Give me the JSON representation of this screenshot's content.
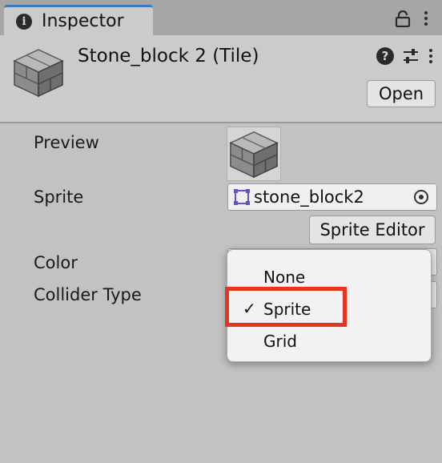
{
  "window": {
    "tab_label": "Inspector"
  },
  "header": {
    "asset_title": "Stone_block 2 (Tile)",
    "open_button": "Open"
  },
  "properties": {
    "preview_label": "Preview",
    "sprite_label": "Sprite",
    "sprite_value": "stone_block2",
    "sprite_editor_button": "Sprite Editor",
    "color_label": "Color",
    "collider_type_label": "Collider Type"
  },
  "collider_dropdown": {
    "options": [
      "None",
      "Sprite",
      "Grid"
    ],
    "selected": "Sprite",
    "check_mark": "✓"
  },
  "colors": {
    "highlight": "#e5361d",
    "tab_accent": "#3a79bb"
  },
  "icons": [
    "info-icon",
    "lock-icon",
    "kebab-menu-icon",
    "help-icon",
    "preset-sliders-icon",
    "stone-block-tile-icon",
    "sprite-icon",
    "object-picker-icon",
    "checkmark-icon"
  ]
}
